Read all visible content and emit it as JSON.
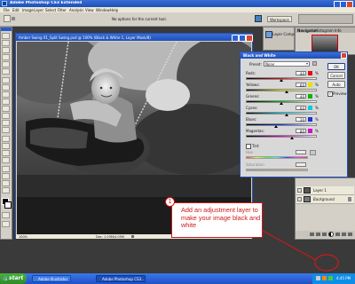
{
  "app": {
    "title": "Adobe Photoshop CS3 Extended",
    "menu": [
      "File",
      "Edit",
      "Image",
      "Layer",
      "Select",
      "Filter",
      "Analysis",
      "View",
      "Window",
      "Help"
    ],
    "options_hint": "No options for the current tool.",
    "workspace_label": "Workspace"
  },
  "document": {
    "title": "Amber Swing 01_Split Swing.psd @ 100% (Black & White 1, Layer Mask/8)",
    "zoom": "100%",
    "doc_info": "Doc: 1.03M/4.05M"
  },
  "bw_dialog": {
    "title": "Black and White",
    "preset_label": "Preset:",
    "preset_value": "None",
    "sliders": [
      {
        "label": "Reds:",
        "value": "40",
        "unit": "%",
        "color": "#e01010"
      },
      {
        "label": "Yellows:",
        "value": "60",
        "unit": "%",
        "color": "#e8e000"
      },
      {
        "label": "Greens:",
        "value": "40",
        "unit": "%",
        "color": "#10b010"
      },
      {
        "label": "Cyans:",
        "value": "60",
        "unit": "%",
        "color": "#10c8d8"
      },
      {
        "label": "Blues:",
        "value": "20",
        "unit": "%",
        "color": "#2030d8"
      },
      {
        "label": "Magentas:",
        "value": "80",
        "unit": "%",
        "color": "#d010c8"
      }
    ],
    "tint_label": "Tint",
    "hue_label": "Hue",
    "saturation_label": "Saturation",
    "buttons": {
      "ok": "OK",
      "cancel": "Cancel",
      "auto": "Auto"
    },
    "preview_label": "Preview"
  },
  "panels": {
    "layer_comps_tab": "Layer Comps",
    "navigator_tab": "Navigator",
    "histogram_tab": "Histogram",
    "info_tab": "Info",
    "layers": [
      {
        "name": "Layer 1"
      },
      {
        "name": "Background"
      }
    ]
  },
  "callout": {
    "number": "1",
    "text": "Add an adjustment layer to make your image black and white"
  },
  "taskbar": {
    "start": "start",
    "items": [
      "Adobe Illustrator",
      "Adobe Photoshop CS3..."
    ],
    "clock": "4:45 PM"
  }
}
